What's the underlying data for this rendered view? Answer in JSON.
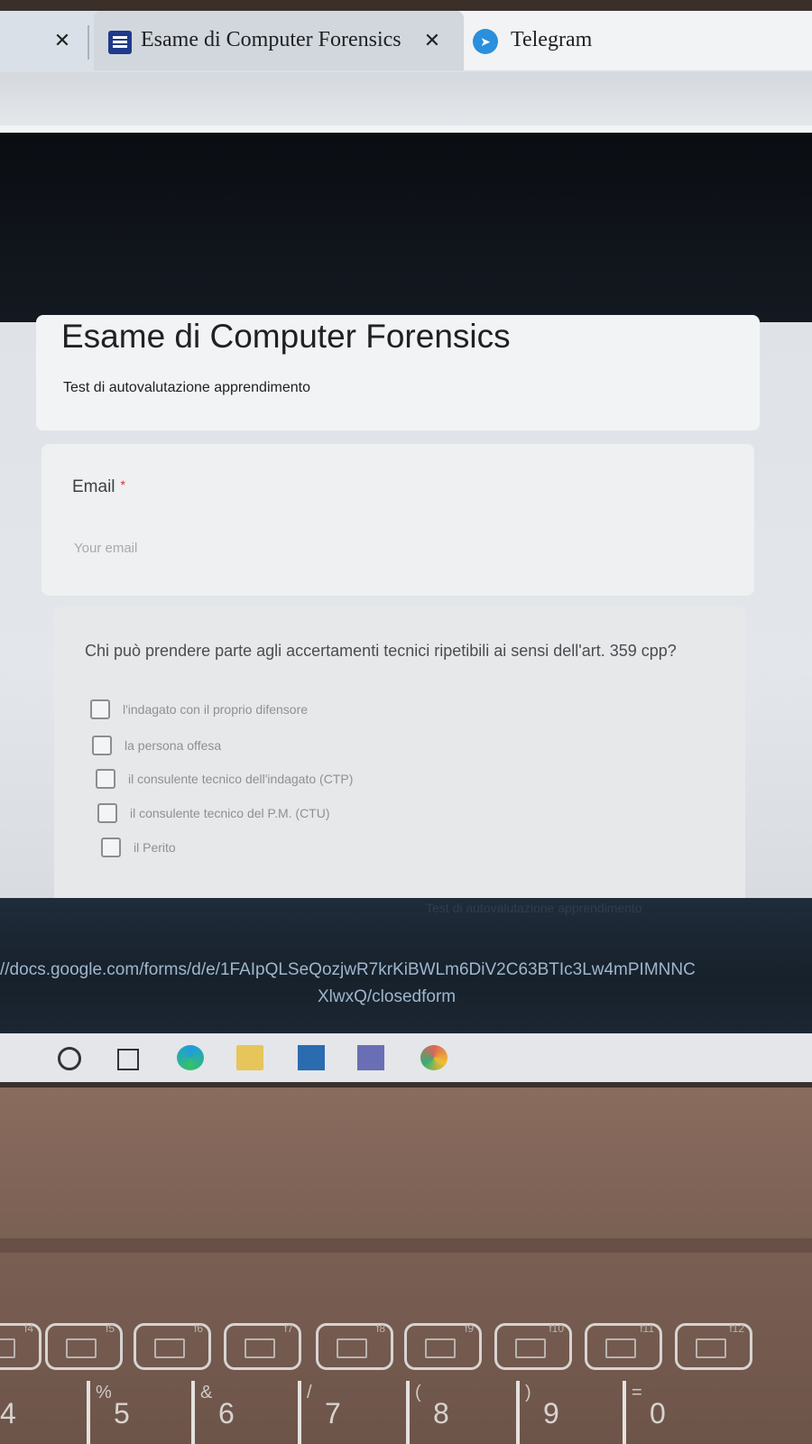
{
  "browser": {
    "tabs": [
      {
        "title": "Esame di Computer Forensics",
        "icon": "google-forms-icon",
        "active": true
      },
      {
        "title": "Telegram",
        "icon": "telegram-icon",
        "active": false
      }
    ],
    "close_glyph": "✕"
  },
  "form": {
    "title": "Esame di Computer Forensics",
    "description": "Test di autovalutazione apprendimento",
    "email": {
      "label": "Email",
      "required_mark": "*",
      "placeholder": "Your email",
      "value": ""
    },
    "question": {
      "text": "Chi può prendere parte agli accertamenti tecnici ripetibili ai sensi dell'art. 359 cpp?",
      "options": [
        {
          "label": "l'indagato con il proprio difensore",
          "checked": false
        },
        {
          "label": "la persona offesa",
          "checked": false
        },
        {
          "label": "il consulente tecnico dell'indagato (CTP)",
          "checked": false
        },
        {
          "label": "il consulente tecnico del P.M. (CTU)",
          "checked": false
        },
        {
          "label": "il Perito",
          "checked": false
        }
      ]
    }
  },
  "status_bar": {
    "ghost_text": "Test di autovalutazione apprendimento",
    "url_line1": "//docs.google.com/forms/d/e/1FAIpQLSeQozjwR7krKiBWLm6DiV2C63BTIc3Lw4mPIMNNC",
    "url_line2": "XlwxQ/closedform"
  },
  "taskbar": {
    "icons": [
      "cortana-circle-icon",
      "task-view-icon",
      "edge-icon",
      "file-explorer-icon",
      "mail-icon",
      "teams-icon",
      "chrome-icon"
    ]
  },
  "keyboard": {
    "function_keys": [
      "f4",
      "f5",
      "f6",
      "f7",
      "f8",
      "f9",
      "f10",
      "f11",
      "f12"
    ],
    "number_keys": [
      {
        "main": "4",
        "shift": ""
      },
      {
        "main": "5",
        "shift": "%"
      },
      {
        "main": "6",
        "shift": "&"
      },
      {
        "main": "7",
        "shift": "/"
      },
      {
        "main": "8",
        "shift": "("
      },
      {
        "main": "9",
        "shift": ")"
      },
      {
        "main": "0",
        "shift": "="
      }
    ]
  },
  "colors": {
    "required": "#d93025",
    "header_dark": "#0a0d12",
    "telegram": "#2a8fdc",
    "forms_icon": "#1f3a8a"
  }
}
